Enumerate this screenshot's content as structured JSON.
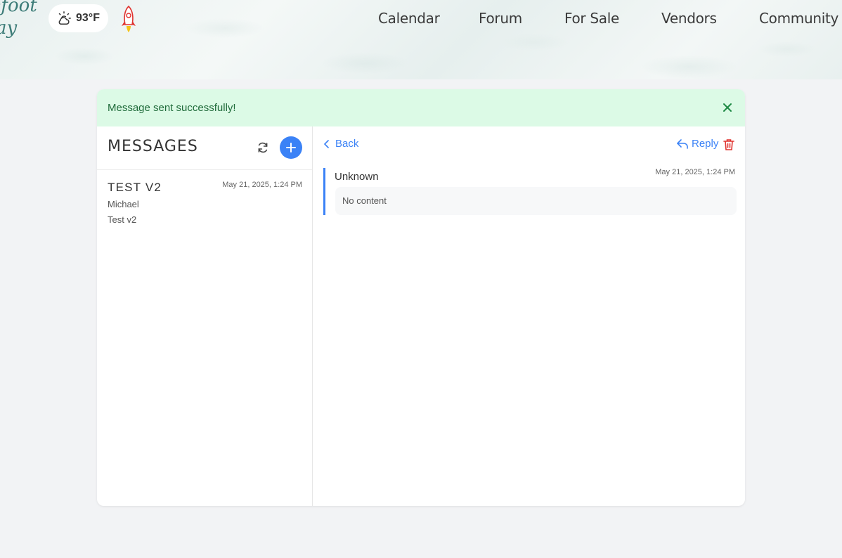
{
  "header": {
    "logo_lines": [
      "efoot",
      "ay"
    ],
    "weather": {
      "icon": "partly-cloudy-icon",
      "temperature": "93°F"
    },
    "rocket_icon": "rocket-icon",
    "nav": [
      {
        "label": "Calendar"
      },
      {
        "label": "Forum"
      },
      {
        "label": "For Sale"
      },
      {
        "label": "Vendors"
      },
      {
        "label": "Community"
      }
    ]
  },
  "alert": {
    "message": "Message sent successfully!",
    "close_icon": "close-icon",
    "color": "#dcfae6"
  },
  "sidebar": {
    "title": "MESSAGES",
    "refresh_icon": "refresh-icon",
    "new_icon": "plus-icon",
    "threads": [
      {
        "subject": "TEST V2",
        "date": "May 21, 2025, 1:24 PM",
        "from": "Michael",
        "preview": "Test v2"
      }
    ]
  },
  "detail": {
    "back_label": "Back",
    "reply_label": "Reply",
    "message": {
      "sender": "Unknown",
      "date": "May 21, 2025, 1:24 PM",
      "body": "No content"
    }
  },
  "colors": {
    "accent": "#3b82f6",
    "danger": "#e0332f",
    "success_bg": "#dcfae6",
    "success_text": "#1f6b3a"
  }
}
